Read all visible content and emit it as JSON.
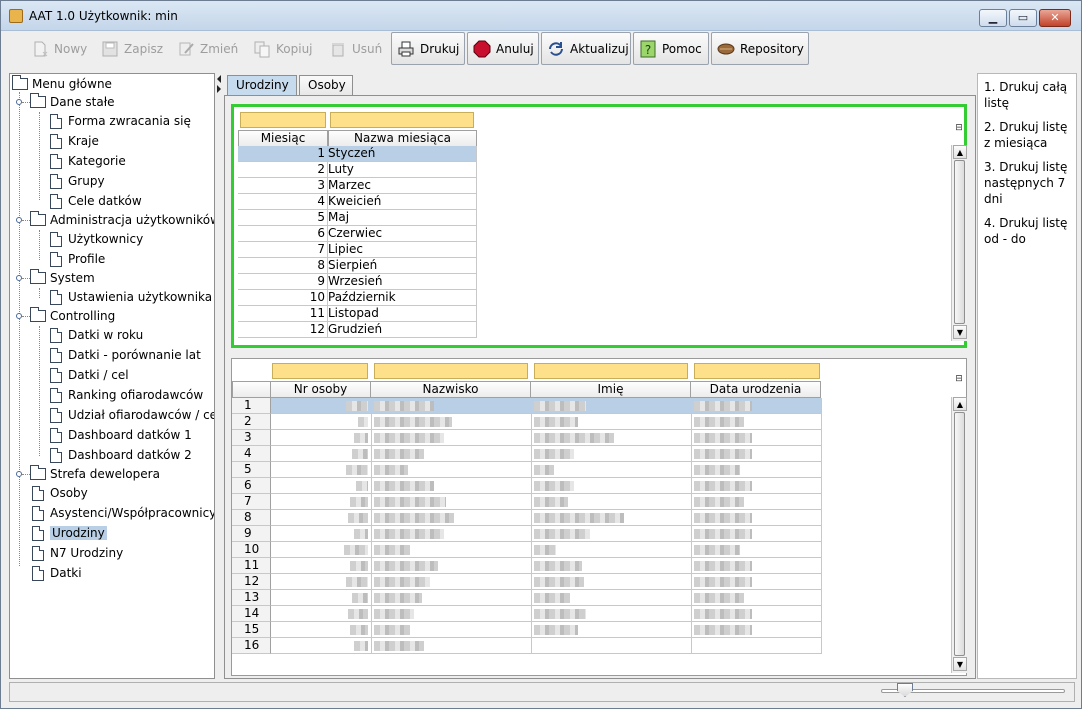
{
  "window": {
    "title": "AAT 1.0  Użytkownik: min",
    "controls": {
      "minimize": "▁",
      "maximize": "▭",
      "close": "✕"
    }
  },
  "toolbar": {
    "buttons": [
      {
        "label": "Nowy",
        "icon": "new-doc-icon",
        "enabled": false
      },
      {
        "label": "Zapisz",
        "icon": "save-disk-icon",
        "enabled": false
      },
      {
        "label": "Zmień",
        "icon": "edit-pencil-icon",
        "enabled": false
      },
      {
        "label": "Kopiuj",
        "icon": "copy-icon",
        "enabled": false
      },
      {
        "label": "Usuń",
        "icon": "trash-icon",
        "enabled": false
      },
      {
        "label": "Drukuj",
        "icon": "printer-icon",
        "enabled": true
      },
      {
        "label": "Anuluj",
        "icon": "stop-icon",
        "enabled": true
      },
      {
        "label": "Aktualizuj",
        "icon": "refresh-icon",
        "enabled": true
      },
      {
        "label": "Pomoc",
        "icon": "help-icon",
        "enabled": true
      },
      {
        "label": "Repository",
        "icon": "repository-icon",
        "enabled": true
      }
    ]
  },
  "tree": {
    "root": "Menu główne",
    "groups": [
      {
        "label": "Dane stałe",
        "items": [
          "Forma zwracania się",
          "Kraje",
          "Kategorie",
          "Grupy",
          "Cele datków"
        ]
      },
      {
        "label": "Administracja użytkowników",
        "items": [
          "Użytkownicy",
          "Profile"
        ]
      },
      {
        "label": "System",
        "items": [
          "Ustawienia użytkownika"
        ]
      },
      {
        "label": "Controlling",
        "items": [
          "Datki w roku",
          "Datki - porównanie lat",
          "Datki / cel",
          "Ranking ofiarodawców",
          "Udział ofiarodawców / cel",
          "Dashboard datków 1",
          "Dashboard datków 2"
        ]
      },
      {
        "label": "Strefa dewelopera",
        "items": []
      }
    ],
    "leaves": [
      "Osoby",
      "Asystenci/Współpracownicy",
      "Urodziny",
      "N7 Urodziny",
      "Datki"
    ],
    "selected": "Urodziny"
  },
  "tabs": [
    {
      "label": "Urodziny",
      "active": true
    },
    {
      "label": "Osoby",
      "active": false
    }
  ],
  "months_table": {
    "headers": [
      "Miesiąc",
      "Nazwa miesiąca"
    ],
    "rows": [
      {
        "n": "1",
        "name": "Styczeń"
      },
      {
        "n": "2",
        "name": "Luty"
      },
      {
        "n": "3",
        "name": "Marzec"
      },
      {
        "n": "4",
        "name": "Kweicień"
      },
      {
        "n": "5",
        "name": "Maj"
      },
      {
        "n": "6",
        "name": "Czerwiec"
      },
      {
        "n": "7",
        "name": "Lipiec"
      },
      {
        "n": "8",
        "name": "Sierpień"
      },
      {
        "n": "9",
        "name": "Wrzesień"
      },
      {
        "n": "10",
        "name": "Październik"
      },
      {
        "n": "11",
        "name": "Listopad"
      },
      {
        "n": "12",
        "name": "Grudzień"
      }
    ],
    "selected_row": 1
  },
  "people_table": {
    "headers": [
      "Nr osoby",
      "Nazwisko",
      "Imię",
      "Data urodzenia"
    ],
    "row_numbers": [
      "1",
      "2",
      "3",
      "4",
      "5",
      "6",
      "7",
      "8",
      "9",
      "10",
      "11",
      "12",
      "13",
      "14",
      "15",
      "16"
    ],
    "selected_row": 1
  },
  "help_panel": {
    "items": [
      "1. Drukuj całą listę",
      "2. Drukuj listę z miesiąca",
      "3. Drukuj listę następnych 7 dni",
      "4. Drukuj listę od - do"
    ]
  },
  "colors": {
    "accent_selection": "#b8cfe5",
    "filter_yellow": "#ffe08a",
    "grid_highlight": "#33cc33"
  }
}
